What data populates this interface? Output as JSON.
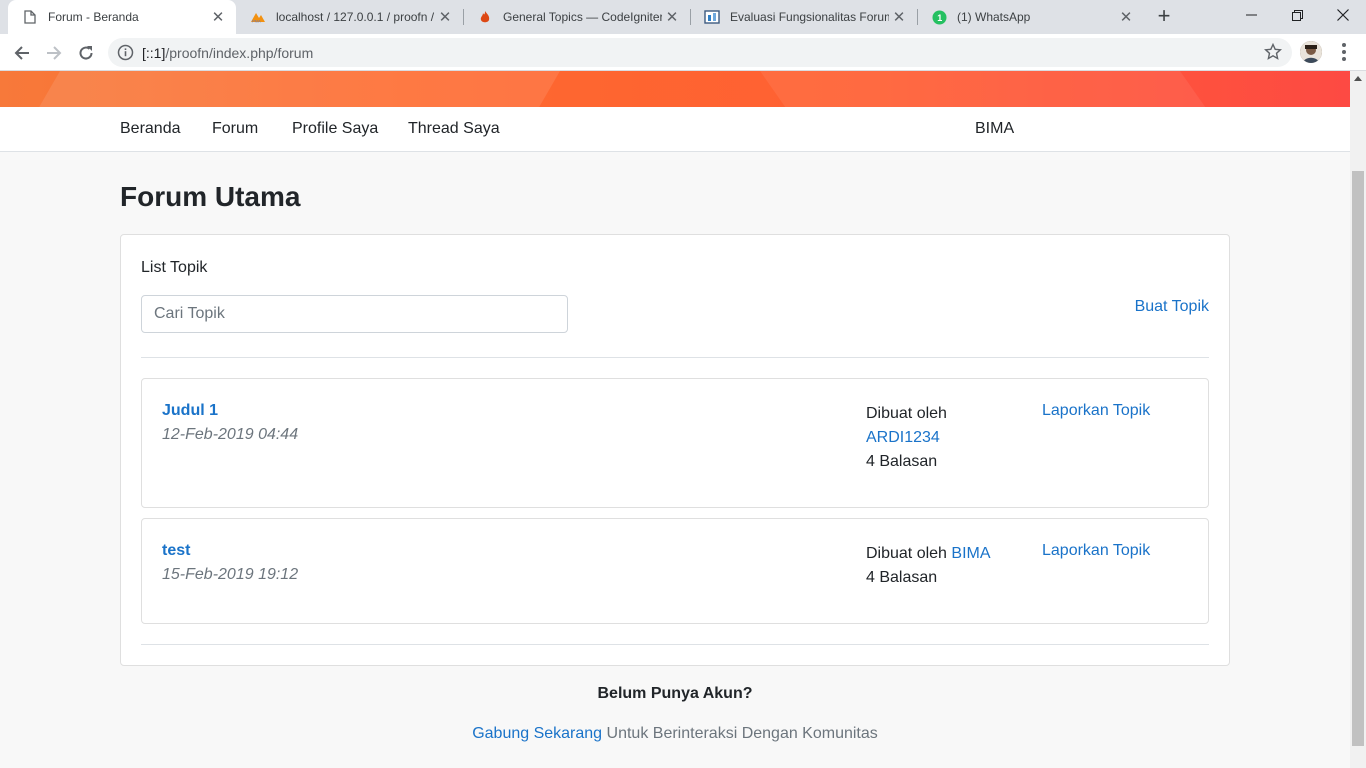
{
  "browser": {
    "tabs": [
      {
        "title": "Forum - Beranda",
        "icon": "page-icon"
      },
      {
        "title": "localhost / 127.0.0.1 / proofn /",
        "icon": "phpmyadmin-icon"
      },
      {
        "title": "General Topics — CodeIgniter",
        "icon": "codeigniter-icon"
      },
      {
        "title": "Evaluasi Fungsionalitas Forum",
        "icon": "document-icon"
      },
      {
        "title": "(1) WhatsApp",
        "icon": "whatsapp-icon",
        "badge": "1"
      }
    ],
    "url_host": "[::1]",
    "url_path": "/proofn/index.php/forum",
    "new_tab_label": "+"
  },
  "nav": {
    "items": [
      "Beranda",
      "Forum",
      "Profile Saya",
      "Thread Saya"
    ],
    "user": "BIMA"
  },
  "page": {
    "title": "Forum Utama",
    "list_label": "List Topik",
    "search_placeholder": "Cari Topik",
    "create_label": "Buat Topik"
  },
  "topics": [
    {
      "title": "Judul 1",
      "date": "12-Feb-2019 04:44",
      "created_by_label": "Dibuat oleh",
      "author": "ARDI1234",
      "replies": "4 Balasan",
      "report_label": "Laporkan Topik"
    },
    {
      "title": "test",
      "date": "15-Feb-2019 19:12",
      "created_by_label": "Dibuat oleh",
      "author": "BIMA",
      "replies": "4 Balasan",
      "report_label": "Laporkan Topik"
    }
  ],
  "footer": {
    "heading": "Belum Punya Akun?",
    "join_link": "Gabung Sekarang",
    "join_text": " Untuk Berinteraksi Dengan Komunitas"
  },
  "colors": {
    "link": "#1a73c9",
    "hero_start": "#f7793a",
    "hero_end": "#fd4a43"
  }
}
